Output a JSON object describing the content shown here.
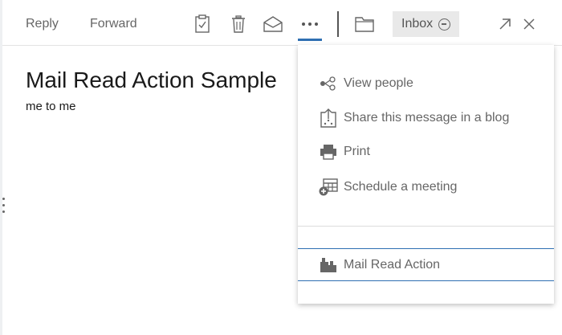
{
  "toolbar": {
    "reply_label": "Reply",
    "forward_label": "Forward",
    "icons": [
      "clipboard-check-icon",
      "trash-icon",
      "envelope-open-icon",
      "more-icon",
      "folder-icon"
    ],
    "folder_chip_label": "Inbox",
    "accent_color": "#2f6fb2"
  },
  "message": {
    "subject": "Mail Read Action Sample",
    "from_to": "me to me"
  },
  "more_menu": {
    "items": [
      {
        "label": "View people",
        "icon": "people-graph-icon"
      },
      {
        "label": "Share this message in a blog",
        "icon": "share-upload-icon"
      },
      {
        "label": "Print",
        "icon": "printer-icon"
      },
      {
        "label": "Schedule a meeting",
        "icon": "calendar-add-icon"
      }
    ],
    "extension_item": {
      "label": "Mail Read Action",
      "icon": "lego-block-icon"
    }
  }
}
